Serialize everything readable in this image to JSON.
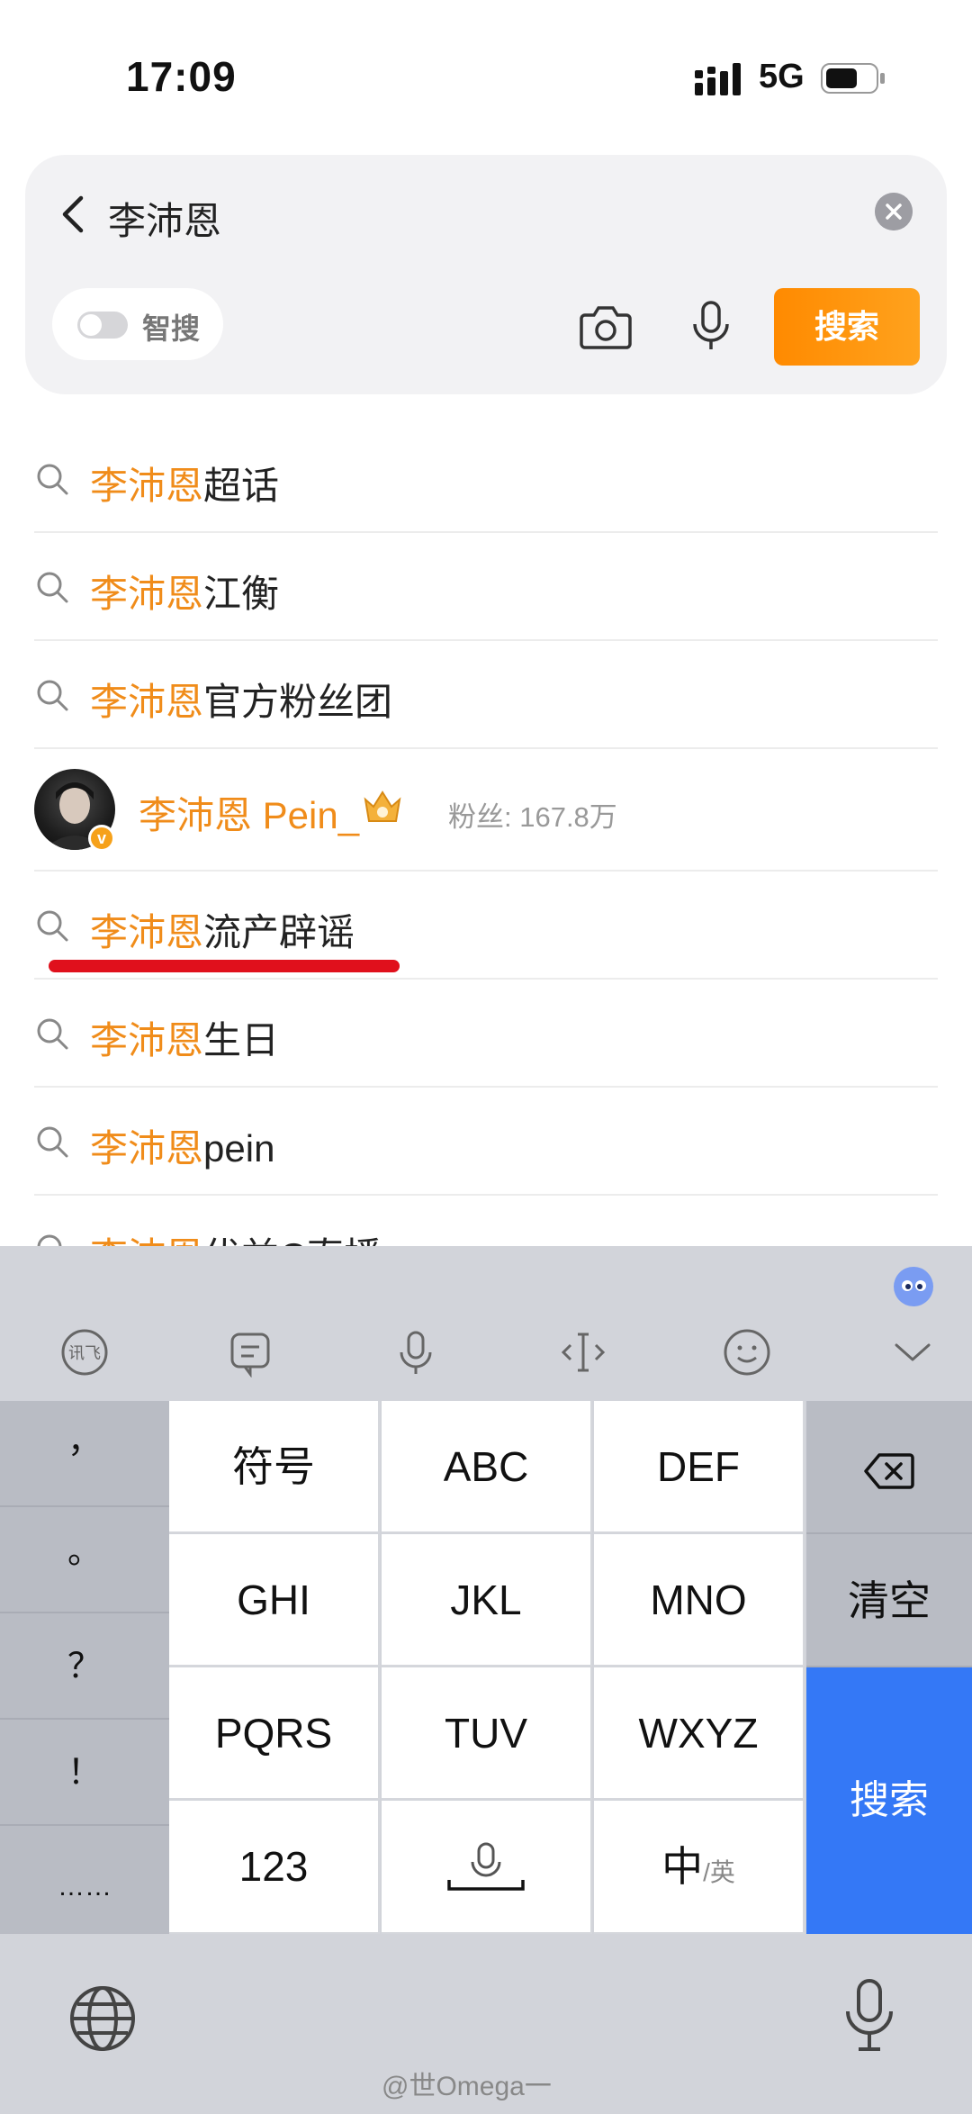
{
  "status_bar": {
    "time": "17:09",
    "network": "5G"
  },
  "search": {
    "query": "李沛恩",
    "smart_search_label": "智搜",
    "search_button": "搜索"
  },
  "suggestions": [
    {
      "highlight": "李沛恩",
      "rest": "超话"
    },
    {
      "highlight": "李沛恩",
      "rest": "江衡"
    },
    {
      "highlight": "李沛恩",
      "rest": "官方粉丝团"
    },
    {
      "highlight": "李沛恩",
      "rest": "流产辟谣"
    },
    {
      "highlight": "李沛恩",
      "rest": "生日"
    },
    {
      "highlight": "李沛恩",
      "rest": "pein"
    },
    {
      "highlight": "李沛恩",
      "rest": "优益C直播"
    }
  ],
  "user_suggestion": {
    "name": "李沛恩 Pein_",
    "fans": "粉丝: 167.8万",
    "badge": "v"
  },
  "keyboard": {
    "symbols": [
      "，",
      "。",
      "？",
      "！",
      "……"
    ],
    "keys": [
      [
        "符号",
        "ABC",
        "DEF"
      ],
      [
        "GHI",
        "JKL",
        "MNO"
      ],
      [
        "PQRS",
        "TUV",
        "WXYZ"
      ],
      [
        "123",
        "",
        "中/英"
      ]
    ],
    "lang_main": "中",
    "lang_alt": "/英",
    "clear_label": "清空",
    "enter_label": "搜索"
  },
  "watermark": "@世Omega一",
  "colors": {
    "highlight": "#f08c1a",
    "search_button": "#ff8a00",
    "enter_key": "#3478f6",
    "underline": "#e0101c"
  }
}
